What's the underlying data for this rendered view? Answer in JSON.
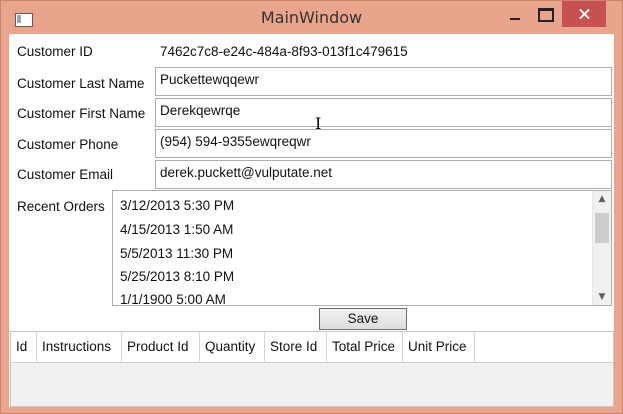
{
  "window": {
    "title": "MainWindow"
  },
  "form": {
    "customer_id_label": "Customer ID",
    "customer_id_value": "7462c7c8-e24c-484a-8f93-013f1c479615",
    "last_name_label": "Customer Last Name",
    "last_name_value": "Puckettewqqewr",
    "first_name_label": "Customer First Name",
    "first_name_value": "Derekqewrqe",
    "phone_label": "Customer Phone",
    "phone_value": "(954) 594-9355ewqreqwr",
    "email_label": "Customer Email",
    "email_value": "derek.puckett@vulputate.net",
    "recent_orders_label": "Recent Orders"
  },
  "recent_orders": [
    "3/12/2013 5:30 PM",
    "4/15/2013 1:50 AM",
    "5/5/2013 11:30 PM",
    "5/25/2013 8:10 PM",
    "1/1/1900 5:00 AM"
  ],
  "save_label": "Save",
  "grid_columns": [
    "Id",
    "Instructions",
    "Product Id",
    "Quantity",
    "Store Id",
    "Total Price",
    "Unit Price"
  ],
  "icons": {
    "cursor": "text-cursor-icon",
    "caret_symbol": "I",
    "scroll_up": "▲",
    "scroll_down": "▼"
  },
  "colors": {
    "frame": "#e9a58c",
    "close_button": "#c75050"
  }
}
